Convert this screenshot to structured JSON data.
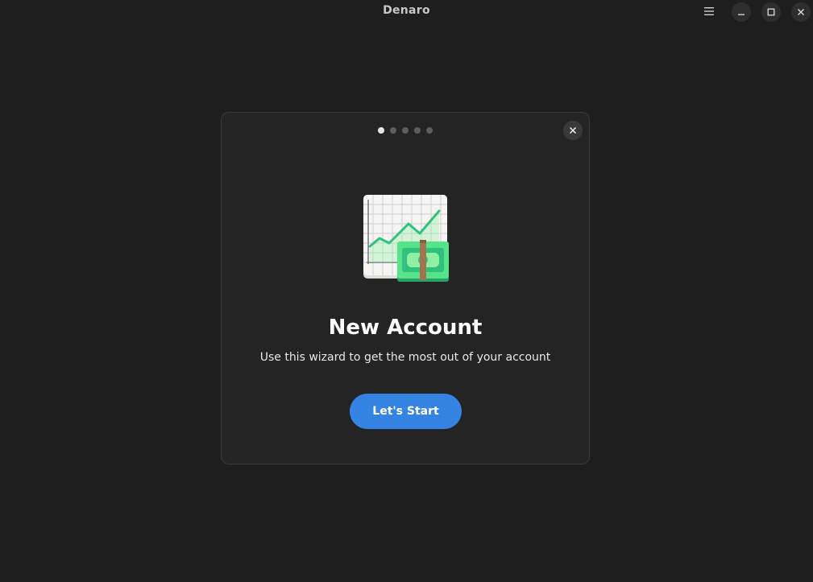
{
  "window": {
    "title": "Denaro"
  },
  "titlebar": {
    "menu_icon": "hamburger-menu-icon",
    "minimize_icon": "minimize-icon",
    "maximize_icon": "maximize-icon",
    "close_icon": "close-icon"
  },
  "dialog": {
    "pages_total": 5,
    "current_page": 1,
    "close_icon": "close-icon",
    "app_icon": "finance-chart-money-icon",
    "heading": "New Account",
    "subtext": "Use this wizard to get the most out of your account",
    "start_label": "Let's Start"
  },
  "colors": {
    "background": "#1e1e1e",
    "dialog_background": "#242424",
    "accent": "#3584e4",
    "chart_green": "#2ec27e"
  }
}
